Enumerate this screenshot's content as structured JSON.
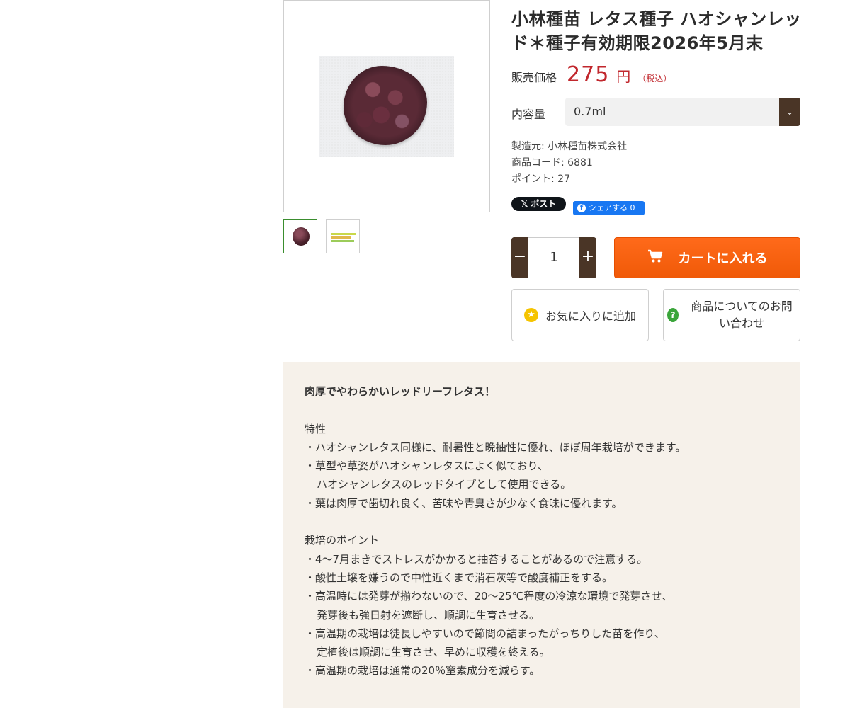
{
  "product": {
    "title": "小林種苗 レタス種子 ハオシャンレッド＊種子有効期限2026年5月末",
    "price_label": "販売価格",
    "price": "275",
    "price_unit": "円",
    "price_tax": "（税込）",
    "quantity_label": "内容量",
    "quantity_selected": "0.7ml",
    "maker": "製造元: 小林種苗株式会社",
    "code": "商品コード: 6881",
    "points": "ポイント: 27"
  },
  "social": {
    "x_post": "ポスト",
    "fb_share": "シェアする 0"
  },
  "purchase": {
    "minus": "−",
    "qty": "1",
    "plus": "+",
    "cart": "カートに入れる",
    "favorite": "お気に入りに追加",
    "inquiry": "商品についてのお問い合わせ"
  },
  "description": {
    "headline": "肉厚でやわらかいレッドリーフレタス！",
    "features_title": "特性",
    "features": [
      "・ハオシャンレタス同様に、耐暑性と晩抽性に優れ、ほぼ周年栽培ができます。",
      "・草型や草姿がハオシャンレタスによく似ており、",
      "ハオシャンレタスのレッドタイプとして使用できる。",
      "・葉は肉厚で歯切れ良く、苦味や青臭さが少なく食味に優れます。"
    ],
    "points_title": "栽培のポイント",
    "points": [
      "・4〜7月まきでストレスがかかると抽苔することがあるので注意する。",
      "・酸性土壌を嫌うので中性近くまで消石灰等で酸度補正をする。",
      "・高温時には発芽が揃わないので、20〜25℃程度の冷涼な環境で発芽させ、",
      "発芽後も強日射を遮断し、順調に生育させる。",
      "・高温期の栽培は徒長しやすいので節間の詰まったがっちりした苗を作り、",
      "定植後は順調に生育させ、早めに収穫を終える。",
      "・高温期の栽培は通常の20％窒素成分を減らす。"
    ]
  },
  "colors": {
    "price": "#c1272d",
    "accent_brown": "#4a3526",
    "cart_orange": "#f05a08",
    "desc_bg": "#f6f1ea"
  }
}
